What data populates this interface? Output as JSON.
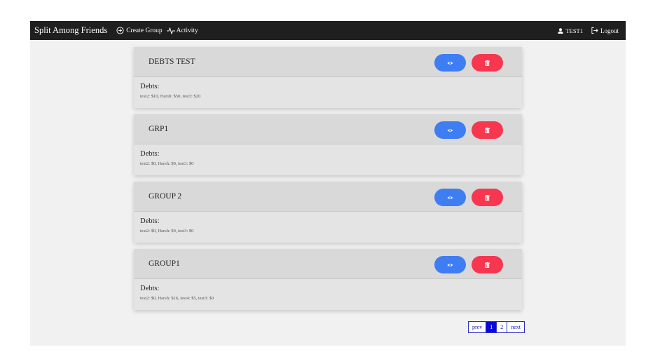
{
  "navbar": {
    "brand": "Split Among Friends",
    "create_group": "Create Group",
    "activity": "Activity",
    "user": "TEST1",
    "logout": "Logout",
    "create_icon": "plus-circle-icon",
    "activity_icon": "activity-pulse-icon",
    "user_icon": "user-icon",
    "logout_icon": "logout-icon"
  },
  "groups": [
    {
      "name": "DEBTS TEST",
      "debts_label": "Debts:",
      "debts": "test2: $10, Harsh: $50, test3: $20"
    },
    {
      "name": "GRP1",
      "debts_label": "Debts:",
      "debts": "test2: $0, Harsh: $0, test3: $0"
    },
    {
      "name": "GROUP 2",
      "debts_label": "Debts:",
      "debts": "test2: $0, Harsh: $0, test3: $0"
    },
    {
      "name": "GROUP1",
      "debts_label": "Debts:",
      "debts": "test2: $0, Harsh: $16, test4: $5, test3: $0"
    }
  ],
  "buttons": {
    "view_icon": "eye-icon",
    "delete_icon": "trash-icon"
  },
  "pagination": {
    "prev": "prev",
    "pages": [
      "1",
      "2"
    ],
    "current": "1",
    "next": "next"
  },
  "colors": {
    "navbar": "#1f1f1f",
    "view": "#3f7df3",
    "delete": "#f7364f",
    "page_active": "#0a0adc"
  }
}
